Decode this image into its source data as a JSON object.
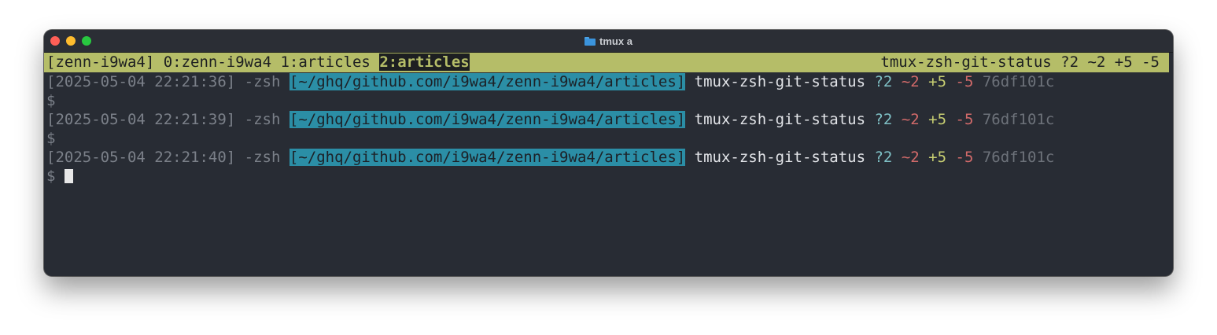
{
  "window": {
    "title": "tmux a",
    "title_icon": "folder-icon"
  },
  "status_bar": {
    "session": "[zenn-i9wa4]",
    "windows": [
      {
        "label": "0:zenn-i9wa4"
      },
      {
        "label": "1:articles"
      },
      {
        "label": "2:articles",
        "active": true
      }
    ],
    "right": "tmux-zsh-git-status ?2 ~2 +5 -5"
  },
  "terminal": {
    "prompts": [
      {
        "timestamp": "[2025-05-04 22:21:36]",
        "shell": "-zsh",
        "path": "[~/ghq/github.com/i9wa4/zenn-i9wa4/articles]",
        "branch": "tmux-zsh-git-status",
        "untracked": "?2",
        "modified": "~2",
        "added": "+5",
        "deleted": "-5",
        "commit": "76df101c",
        "input": "$"
      },
      {
        "timestamp": "[2025-05-04 22:21:39]",
        "shell": "-zsh",
        "path": "[~/ghq/github.com/i9wa4/zenn-i9wa4/articles]",
        "branch": "tmux-zsh-git-status",
        "untracked": "?2",
        "modified": "~2",
        "added": "+5",
        "deleted": "-5",
        "commit": "76df101c",
        "input": "$"
      },
      {
        "timestamp": "[2025-05-04 22:21:40]",
        "shell": "-zsh",
        "path": "[~/ghq/github.com/i9wa4/zenn-i9wa4/articles]",
        "branch": "tmux-zsh-git-status",
        "untracked": "?2",
        "modified": "~2",
        "added": "+5",
        "deleted": "-5",
        "commit": "76df101c",
        "input": "$"
      }
    ]
  },
  "colors": {
    "status_bar": "#b5bd68",
    "path_highlight": "#2b8ea6",
    "background": "#282c34"
  }
}
